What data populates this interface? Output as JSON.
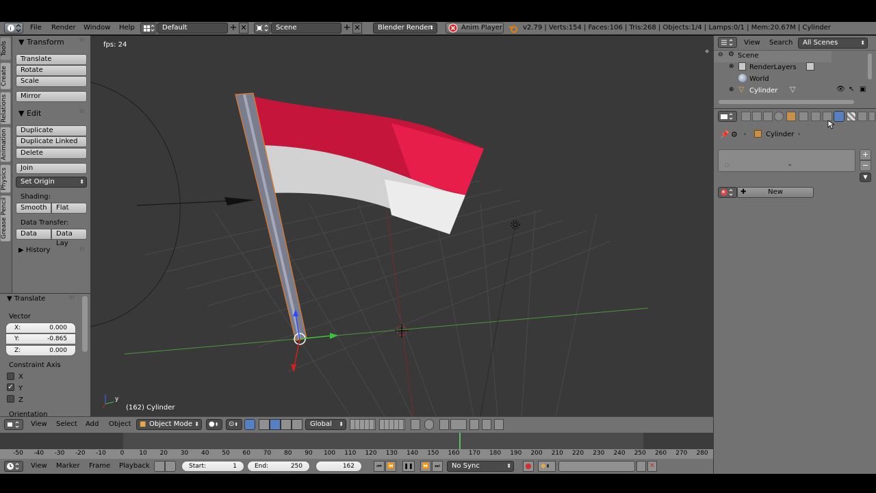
{
  "top_bar": {
    "menus": [
      "File",
      "Render",
      "Window",
      "Help"
    ],
    "screen_layout": "Default",
    "scene": "Scene",
    "render_engine": "Blender Render",
    "anim_player": "Anim Player",
    "stats": "v2.79 | Verts:154 | Faces:106 | Tris:268 | Objects:1/4 | Lamps:0/1 | Mem:20.67M | Cylinder"
  },
  "tool_tabs": [
    "Tools",
    "Create",
    "Relations",
    "Animation",
    "Physics",
    "Grease Pencil"
  ],
  "tools_panel": {
    "transform_header": "Transform",
    "translate": "Translate",
    "rotate": "Rotate",
    "scale": "Scale",
    "mirror": "Mirror",
    "edit_header": "Edit",
    "duplicate": "Duplicate",
    "duplicate_linked": "Duplicate Linked",
    "delete": "Delete",
    "join": "Join",
    "set_origin": "Set Origin",
    "shading_label": "Shading:",
    "smooth": "Smooth",
    "flat": "Flat",
    "data_transfer_label": "Data Transfer:",
    "data": "Data",
    "data_lay": "Data Lay",
    "history_header": "History"
  },
  "operator_panel": {
    "header": "Translate",
    "vector_label": "Vector",
    "x_label": "X:",
    "x_value": "0.000",
    "y_label": "Y:",
    "y_value": "-0.865",
    "z_label": "Z:",
    "z_value": "0.000",
    "constraint_label": "Constraint Axis",
    "cx": "X",
    "cy": "Y",
    "cz": "Z",
    "y_checked": true,
    "orientation_label": "Orientation"
  },
  "viewport": {
    "fps": "fps: 24",
    "object_info": "(162) Cylinder",
    "axis_y": "y"
  },
  "viewport_header": {
    "view": "View",
    "select": "Select",
    "add": "Add",
    "object": "Object",
    "mode": "Object Mode",
    "orientation": "Global"
  },
  "timeline": {
    "ruler": [
      "-50",
      "-40",
      "-30",
      "-20",
      "-10",
      "0",
      "10",
      "20",
      "30",
      "40",
      "50",
      "60",
      "70",
      "80",
      "90",
      "100",
      "110",
      "120",
      "130",
      "140",
      "150",
      "160",
      "170",
      "180",
      "190",
      "200",
      "210",
      "220",
      "230",
      "240",
      "250",
      "260",
      "270",
      "280"
    ],
    "current_frame_marker": 162,
    "menus": [
      "View",
      "Marker",
      "Frame",
      "Playback"
    ],
    "start_label": "Start:",
    "start_value": "1",
    "end_label": "End:",
    "end_value": "250",
    "current": "162",
    "sync": "No Sync"
  },
  "outliner": {
    "view": "View",
    "search": "Search",
    "filter": "All Scenes",
    "items": [
      "Scene",
      "RenderLayers",
      "World",
      "Cylinder"
    ]
  },
  "properties": {
    "breadcrumb": "Cylinder",
    "new_button": "New"
  },
  "colors": {
    "viewport_bg": "#393939",
    "panel_bg": "#727272",
    "header_bg": "#727272",
    "accent_blue": "#5680c2",
    "flag_red": "#d8153a",
    "flag_white": "#e6e6e6"
  }
}
